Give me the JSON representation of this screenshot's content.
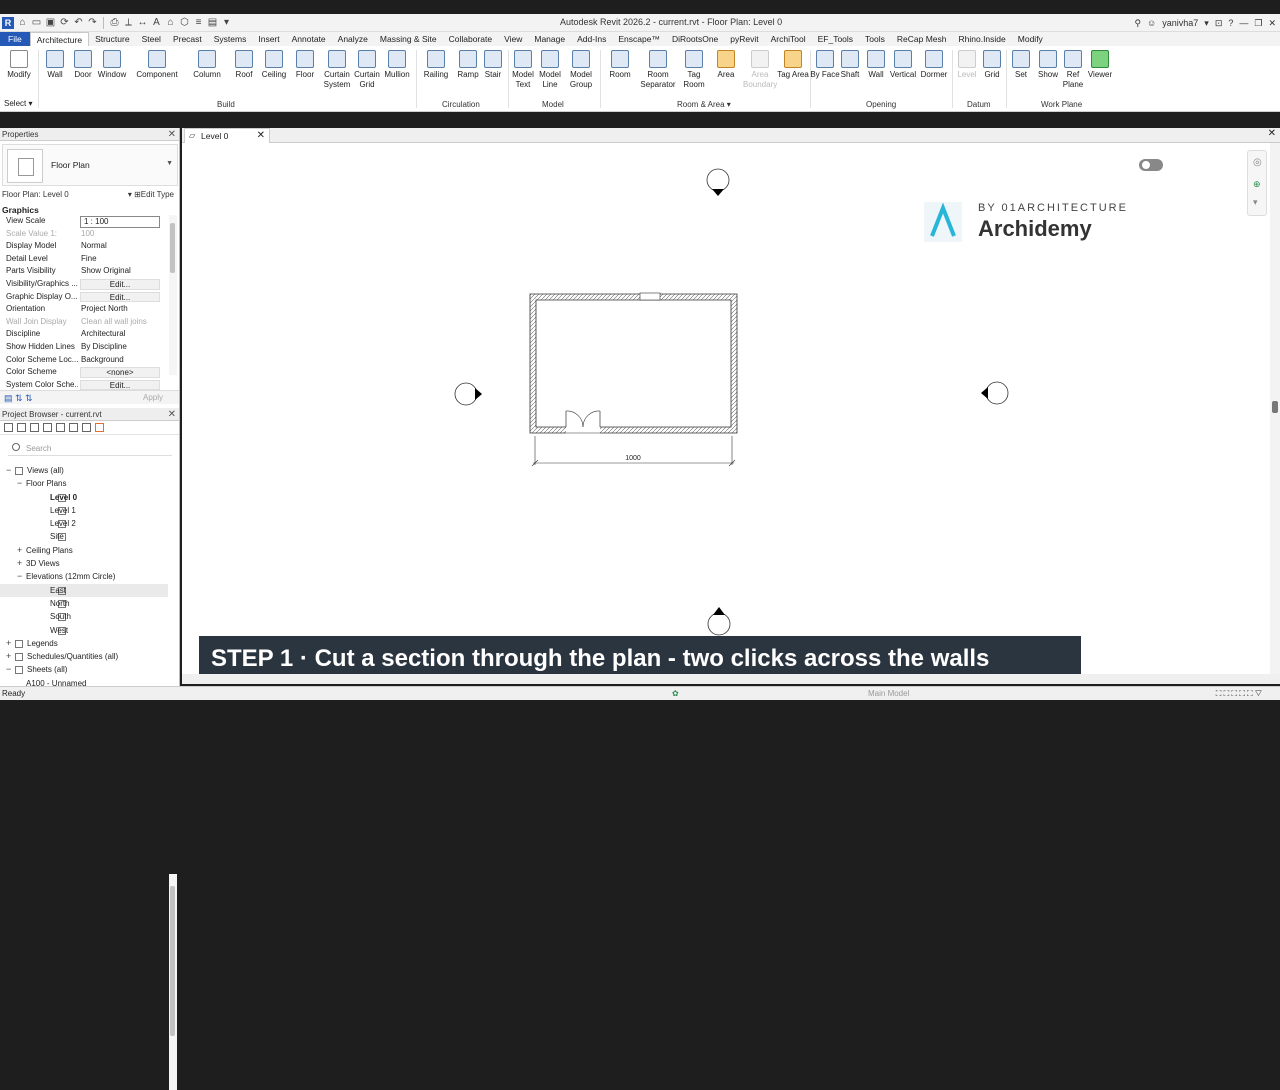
{
  "app": {
    "title": "Autodesk Revit 2026.2 - current.rvt - Floor Plan: Level 0",
    "user": "yanivha7"
  },
  "tabs": [
    "File",
    "Architecture",
    "Structure",
    "Steel",
    "Precast",
    "Systems",
    "Insert",
    "Annotate",
    "Analyze",
    "Massing & Site",
    "Collaborate",
    "View",
    "Manage",
    "Add-Ins",
    "Enscape™",
    "DiRootsOne",
    "pyRevit",
    "ArchiTool",
    "EF_Tools",
    "Tools",
    "ReCap Mesh",
    "Rhino.Inside",
    "Modify"
  ],
  "ribbon": {
    "buttons": {
      "modify": "Modify",
      "wall": "Wall",
      "door": "Door",
      "window": "Window",
      "component": "Component",
      "column": "Column",
      "roof": "Roof",
      "ceiling": "Ceiling",
      "floor": "Floor",
      "curtain_system": "Curtain System",
      "curtain_grid": "Curtain Grid",
      "mullion": "Mullion",
      "railing": "Railing",
      "ramp": "Ramp",
      "stair": "Stair",
      "model_text": "Model Text",
      "model_line": "Model Line",
      "model_group": "Model Group",
      "room": "Room",
      "room_separator": "Room Separator",
      "tag_room": "Tag Room",
      "area": "Area",
      "area_boundary": "Area Boundary",
      "tag_area": "Tag Area",
      "by_face": "By Face",
      "shaft": "Shaft",
      "wall_opening": "Wall",
      "vertical": "Vertical",
      "dormer": "Dormer",
      "level": "Level",
      "grid": "Grid",
      "set": "Set",
      "show": "Show",
      "ref_plane": "Ref Plane",
      "viewer": "Viewer"
    },
    "panels": {
      "select": "Select",
      "build": "Build",
      "circulation": "Circulation",
      "model": "Model",
      "room_area": "Room & Area",
      "opening": "Opening",
      "datum": "Datum",
      "work_plane": "Work Plane"
    }
  },
  "properties": {
    "header": "Properties",
    "type_name": "Floor Plan",
    "instance": "Floor Plan: Level 0",
    "edit_type": "Edit Type",
    "group": "Graphics",
    "apply": "Apply",
    "rows": [
      {
        "k": "View Scale",
        "v": "1 : 100"
      },
      {
        "k": "Scale Value    1:",
        "v": "100"
      },
      {
        "k": "Display Model",
        "v": "Normal"
      },
      {
        "k": "Detail Level",
        "v": "Fine"
      },
      {
        "k": "Parts Visibility",
        "v": "Show Original"
      },
      {
        "k": "Visibility/Graphics ...",
        "v": "Edit..."
      },
      {
        "k": "Graphic Display O...",
        "v": "Edit..."
      },
      {
        "k": "Orientation",
        "v": "Project North"
      },
      {
        "k": "Wall Join Display",
        "v": "Clean all wall joins"
      },
      {
        "k": "Discipline",
        "v": "Architectural"
      },
      {
        "k": "Show Hidden Lines",
        "v": "By Discipline"
      },
      {
        "k": "Color Scheme Loc...",
        "v": "Background"
      },
      {
        "k": "Color Scheme",
        "v": "<none>"
      },
      {
        "k": "System Color Sche...",
        "v": "Edit..."
      }
    ]
  },
  "browser": {
    "header": "Project Browser - current.rvt",
    "search_placeholder": "Search",
    "tree": [
      {
        "label": "Views (all)",
        "depth": 0,
        "toggle": "−"
      },
      {
        "label": "Floor Plans",
        "depth": 1,
        "toggle": "−"
      },
      {
        "label": "Level 0",
        "depth": 2
      },
      {
        "label": "Level 1",
        "depth": 2
      },
      {
        "label": "Level 2",
        "depth": 2
      },
      {
        "label": "Site",
        "depth": 2
      },
      {
        "label": "Ceiling Plans",
        "depth": 1,
        "toggle": "+"
      },
      {
        "label": "3D Views",
        "depth": 1,
        "toggle": "+"
      },
      {
        "label": "Elevations (12mm Circle)",
        "depth": 1,
        "toggle": "−"
      },
      {
        "label": "East",
        "depth": 2
      },
      {
        "label": "North",
        "depth": 2
      },
      {
        "label": "South",
        "depth": 2
      },
      {
        "label": "West",
        "depth": 2
      },
      {
        "label": "Legends",
        "depth": 0,
        "toggle": "+"
      },
      {
        "label": "Schedules/Quantities (all)",
        "depth": 0,
        "toggle": "+"
      },
      {
        "label": "Sheets (all)",
        "depth": 0,
        "toggle": "−"
      },
      {
        "label": "A100 - Unnamed",
        "depth": 1
      }
    ]
  },
  "view_tab": "Level 0",
  "plan": {
    "dimension": "1000"
  },
  "logo": {
    "sub": "BY 01ARCHITECTURE",
    "name": "Archidemy"
  },
  "banner": "STEP 1  ·  Cut a section through the plan - two clicks across the walls",
  "status": {
    "left": "Ready",
    "right": "Main Model"
  },
  "colors": {
    "revit_blue": "#2459b8",
    "banner_bg": "#2b3540",
    "logo_cyan": "#28b6d8"
  }
}
